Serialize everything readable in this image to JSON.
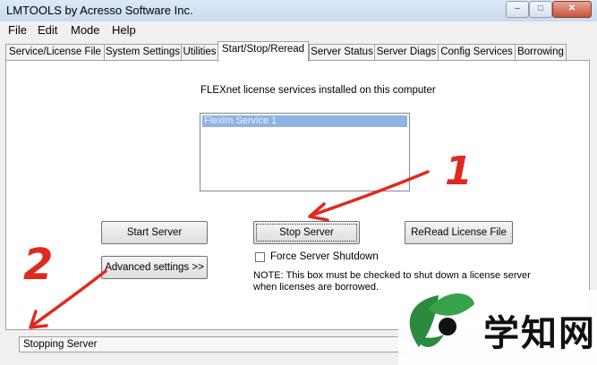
{
  "window": {
    "title": "LMTOOLS by Acresso Software Inc.",
    "controls": {
      "minimize": "–",
      "maximize": "□",
      "close": "✕"
    }
  },
  "menu": {
    "file": "File",
    "edit": "Edit",
    "mode": "Mode",
    "help": "Help"
  },
  "tabs": [
    {
      "label": "Service/License File"
    },
    {
      "label": "System Settings"
    },
    {
      "label": "Utilities"
    },
    {
      "label": "Start/Stop/Reread",
      "active": true
    },
    {
      "label": "Server Status"
    },
    {
      "label": "Server Diags"
    },
    {
      "label": "Config Services"
    },
    {
      "label": "Borrowing"
    }
  ],
  "panel": {
    "installed_label": "FLEXnet license services installed on this computer",
    "services": [
      "Flexlm Service 1"
    ],
    "buttons": {
      "start": "Start Server",
      "stop": "Stop Server",
      "reread": "ReRead License File",
      "advanced": "Advanced settings >>"
    },
    "force_shutdown_label": "Force Server Shutdown",
    "force_shutdown_checked": false,
    "note_line1": "NOTE:  This box must be checked to shut down a license server",
    "note_line2": "when licenses are borrowed."
  },
  "status": {
    "text": "Stopping Server"
  },
  "annotations": {
    "mark1": "1",
    "mark2": "2",
    "color": "#e02a1e"
  },
  "watermark": {
    "text": "学知网",
    "icon": "leaf-logo-icon"
  }
}
